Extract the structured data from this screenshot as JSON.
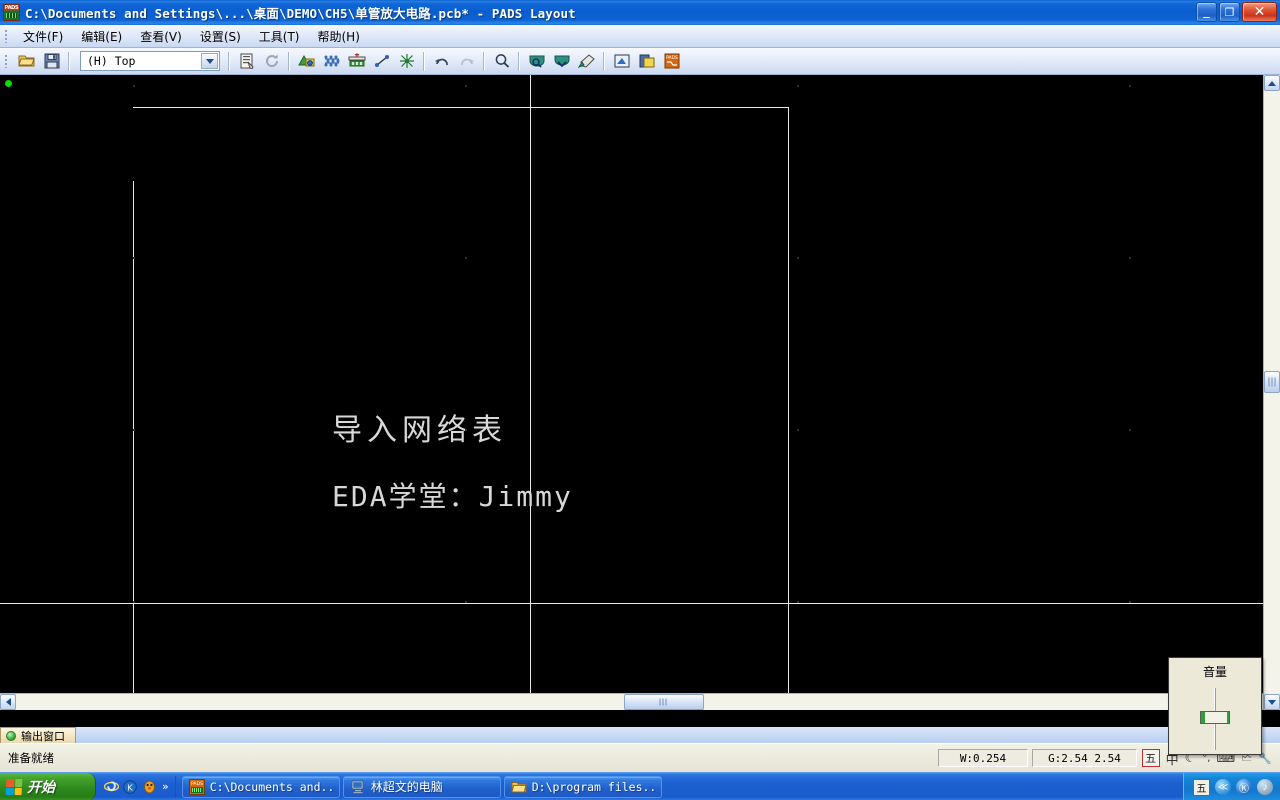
{
  "window": {
    "title": "C:\\Documents and Settings\\...\\桌面\\DEMO\\CH5\\单管放大电路.pcb* - PADS Layout",
    "app_icon": "pads-app-icon",
    "controls": {
      "minimize": "_",
      "restore": "❐",
      "close": "✕"
    }
  },
  "menu": {
    "items": [
      {
        "label": "文件(F)",
        "name": "menu-file"
      },
      {
        "label": "编辑(E)",
        "name": "menu-edit"
      },
      {
        "label": "查看(V)",
        "name": "menu-view"
      },
      {
        "label": "设置(S)",
        "name": "menu-setup"
      },
      {
        "label": "工具(T)",
        "name": "menu-tools"
      },
      {
        "label": "帮助(H)",
        "name": "menu-help"
      }
    ]
  },
  "toolbar": {
    "layer_combo": {
      "value": "(H)  Top",
      "name": "layer-select"
    },
    "buttons": [
      {
        "name": "open-file-button",
        "icon": "open-folder-icon",
        "tooltip": "打开"
      },
      {
        "name": "save-file-button",
        "icon": "floppy-disk-icon",
        "tooltip": "保存"
      },
      {
        "name": "drafting-toolbar-button",
        "icon": "clipboard-icon",
        "tooltip": "绘图工具栏"
      },
      {
        "name": "refresh-button",
        "icon": "refresh-icon",
        "tooltip": "刷新"
      },
      {
        "name": "design-toolbar-button",
        "icon": "design-icon",
        "tooltip": "设计工具栏"
      },
      {
        "name": "pour-toolbar-button",
        "icon": "pour-manager-icon",
        "tooltip": "灌铜管理"
      },
      {
        "name": "eco-toolbar-button",
        "icon": "eco-toolbox-icon",
        "tooltip": "ECO 工具栏"
      },
      {
        "name": "route-button",
        "icon": "route-line-icon",
        "tooltip": "布线"
      },
      {
        "name": "net-button",
        "icon": "net-star-icon",
        "tooltip": "网络"
      },
      {
        "name": "undo-button",
        "icon": "undo-arrow-icon",
        "tooltip": "撤销"
      },
      {
        "name": "redo-button",
        "icon": "redo-arrow-icon",
        "tooltip": "恢复"
      },
      {
        "name": "zoom-button",
        "icon": "magnifier-icon",
        "tooltip": "缩放"
      },
      {
        "name": "zoom-in-button",
        "icon": "zoom-in-icon",
        "tooltip": "放大"
      },
      {
        "name": "zoom-fit-button",
        "icon": "zoom-fit-icon",
        "tooltip": "适合页面"
      },
      {
        "name": "redraw-button",
        "icon": "paintbrush-icon",
        "tooltip": "重画"
      },
      {
        "name": "pcb-view-button",
        "icon": "pcb-view-icon",
        "tooltip": "视图"
      },
      {
        "name": "library-button",
        "icon": "library-icon",
        "tooltip": "库"
      },
      {
        "name": "pads-router-button",
        "icon": "pads-router-icon",
        "tooltip": "PADS Router"
      }
    ]
  },
  "canvas": {
    "background_color": "#000000",
    "origin_marker_color": "#00e000",
    "outline_color": "#e8e8e8",
    "overlay_texts": [
      {
        "text": "导入网络表",
        "name": "canvas-title-text"
      },
      {
        "text": "EDA学堂：Jimmy",
        "name": "canvas-author-text"
      }
    ]
  },
  "output_panel": {
    "tab_label": "输出窗口",
    "tab_name": "tab-output-window"
  },
  "statusbar": {
    "message": "准备就绪",
    "width_field": "W:0.254",
    "grid_field": "G:2.54  2.54",
    "ime": {
      "mode_box": "五",
      "lang": "中",
      "moon": "☾",
      "punct": "°,",
      "keyboard": "⌨",
      "tools": "🗠",
      "wrench": "🔧"
    }
  },
  "volume_popup": {
    "title": "音量",
    "name": "volume-flyout"
  },
  "taskbar": {
    "start_label": "开始",
    "quick_launch": [
      {
        "name": "ie-browser-icon",
        "glyph": "e"
      },
      {
        "name": "kingsoft-icon",
        "glyph": "Ⓚ"
      },
      {
        "name": "qq-icon",
        "glyph": "🐧"
      }
    ],
    "quick_launch_more": "»",
    "tasks": [
      {
        "label": "C:\\Documents and...",
        "icon": "pads-layout-icon",
        "name": "taskbtn-pads-layout",
        "cjk": false
      },
      {
        "label": "林超文的电脑",
        "icon": "my-computer-icon",
        "name": "taskbtn-my-computer",
        "cjk": true
      },
      {
        "label": "D:\\program files...",
        "icon": "folder-icon",
        "name": "taskbtn-explorer",
        "cjk": false
      }
    ],
    "tray": [
      {
        "name": "tray-ime-icon",
        "glyph": "五"
      },
      {
        "name": "tray-network-icon",
        "glyph": "≪"
      },
      {
        "name": "tray-kingsoft-icon",
        "glyph": "Ⓚ"
      },
      {
        "name": "tray-volume-icon",
        "glyph": "♪"
      }
    ]
  }
}
